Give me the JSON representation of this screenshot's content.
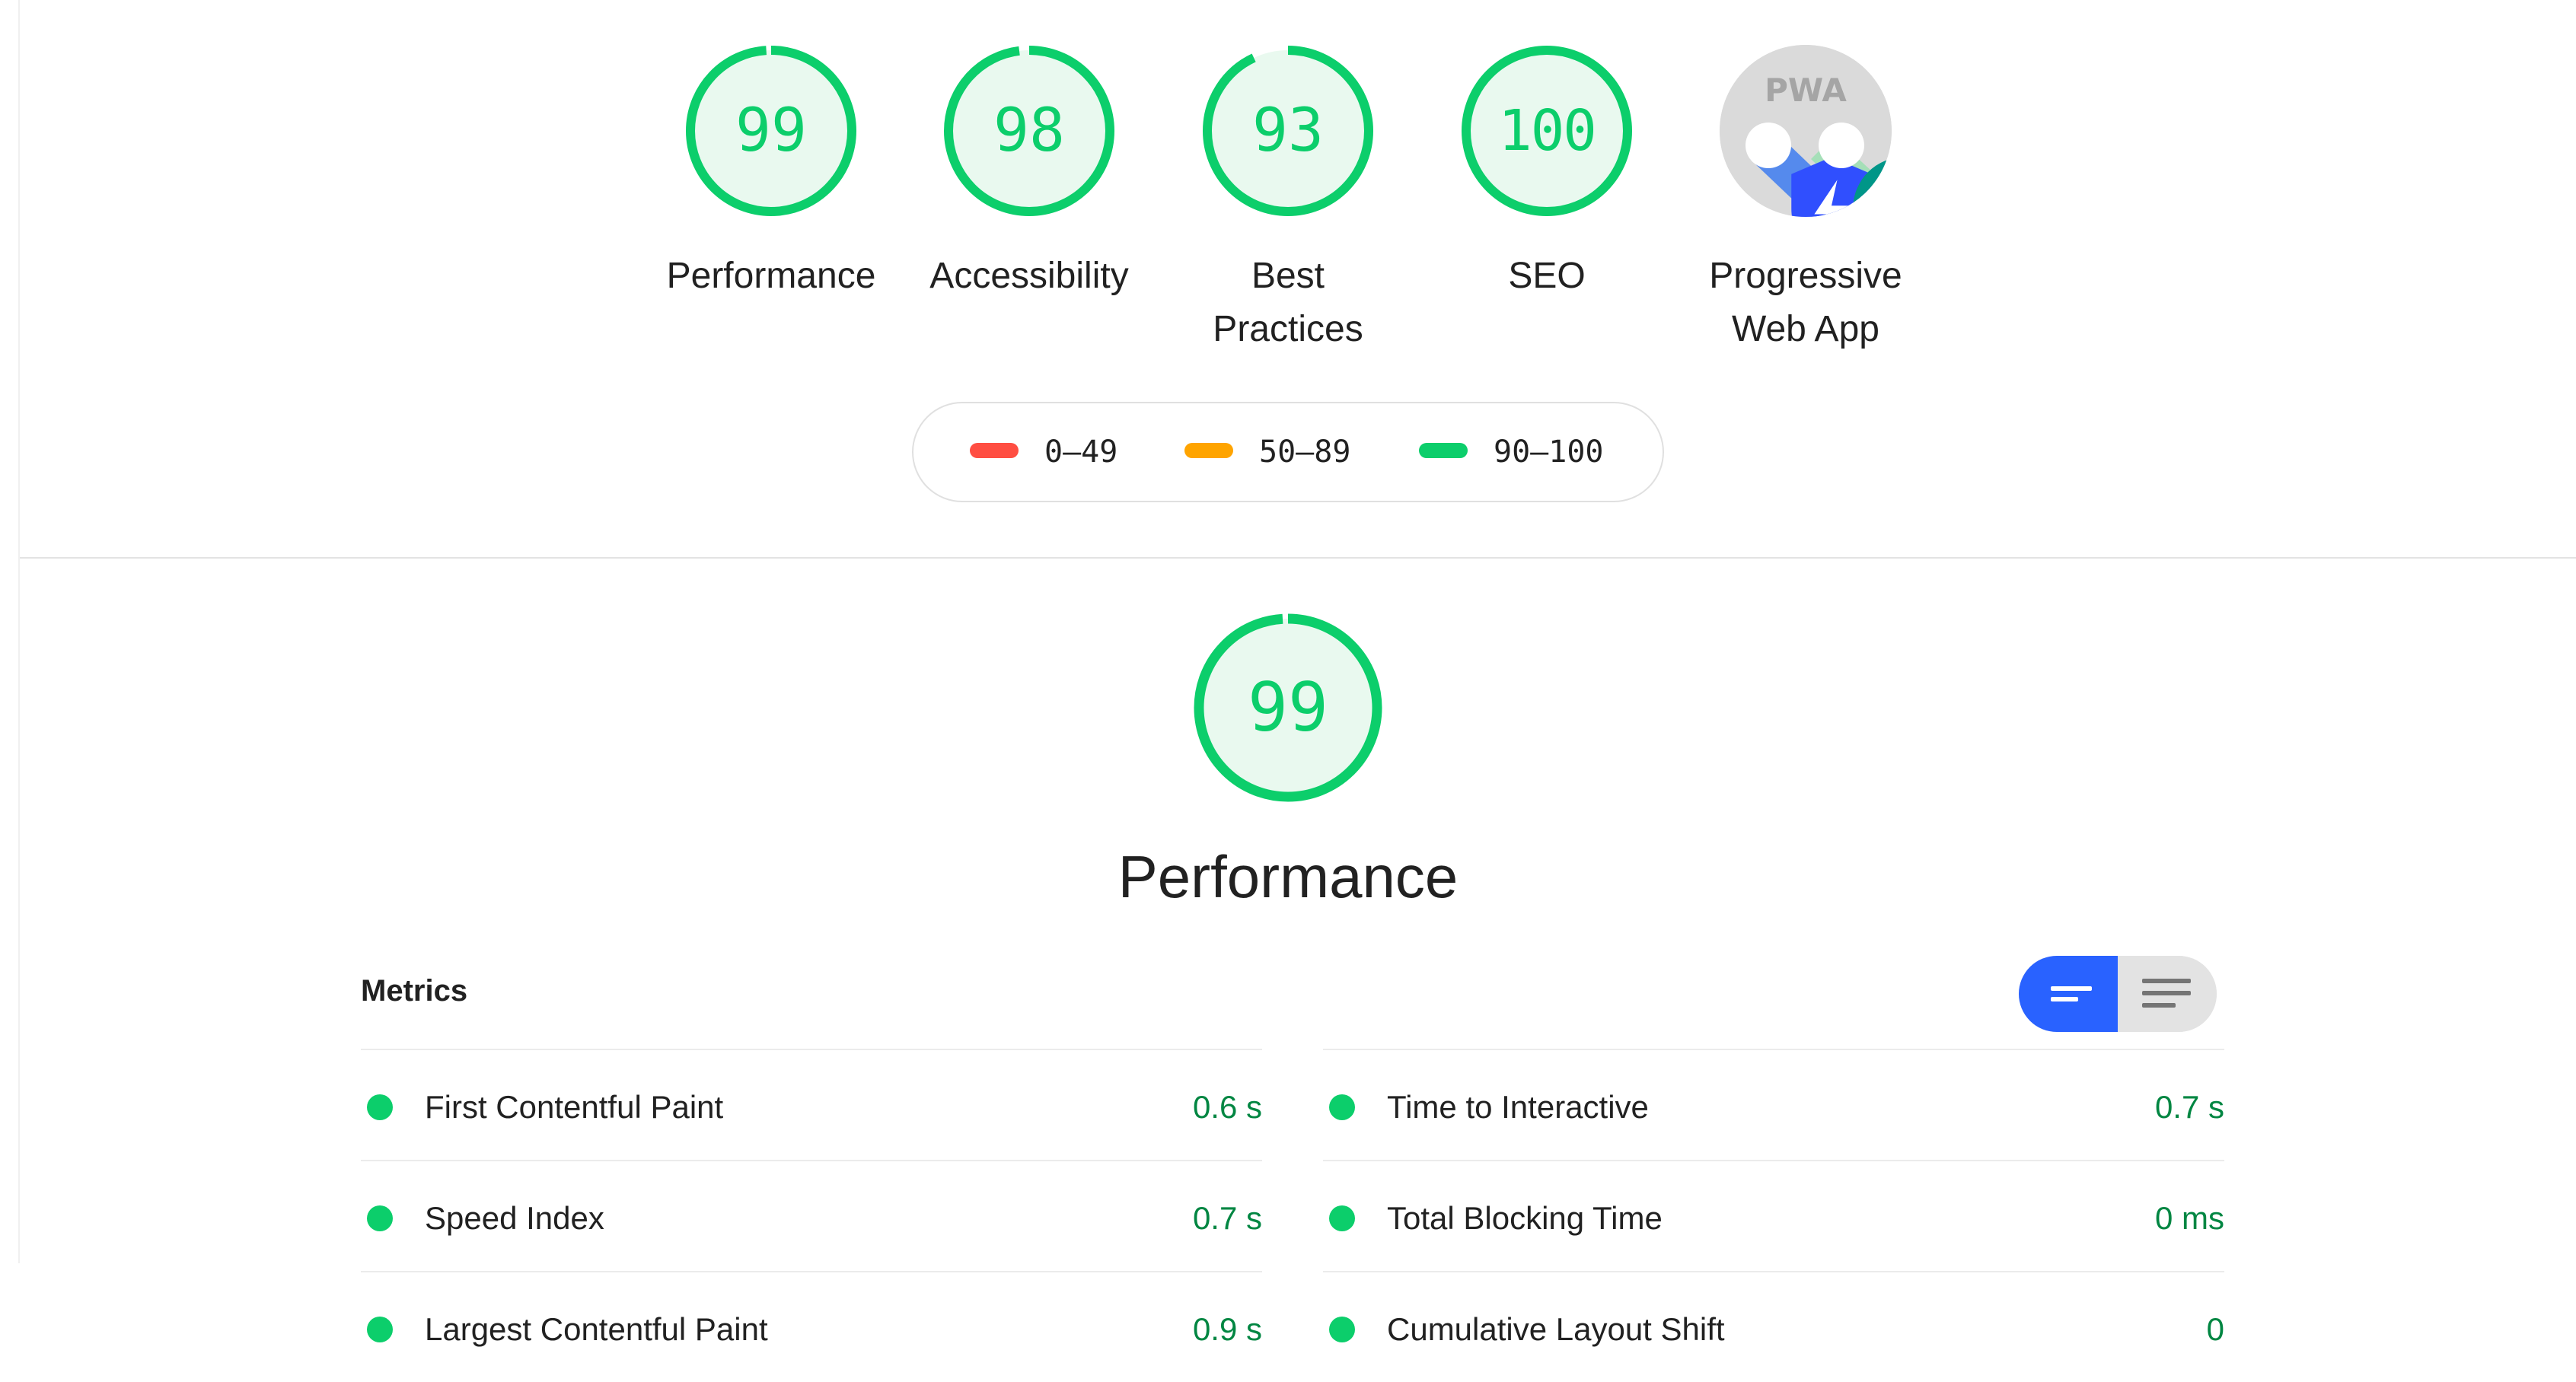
{
  "colors": {
    "pass": "#0cce6b",
    "pass_fill": "#e9f9ef",
    "pass_text": "#018642",
    "average": "#ffa400",
    "fail": "#ff4e42",
    "toggle_active": "#2962ff"
  },
  "categories": [
    {
      "score": "99",
      "score_value": 99,
      "label": "Performance"
    },
    {
      "score": "98",
      "score_value": 98,
      "label": "Accessibility"
    },
    {
      "score": "93",
      "score_value": 93,
      "label": "Best Practices"
    },
    {
      "score": "100",
      "score_value": 100,
      "label": "SEO"
    }
  ],
  "pwa": {
    "badge_text": "PWA",
    "label": "Progressive Web App",
    "icons": [
      "fast-reliable-shield-icon",
      "installable-plus-icon"
    ]
  },
  "legend": [
    {
      "range": "0–49",
      "color": "#ff4e42"
    },
    {
      "range": "50–89",
      "color": "#ffa400"
    },
    {
      "range": "90–100",
      "color": "#0cce6b"
    }
  ],
  "section": {
    "score": "99",
    "score_value": 99,
    "title": "Performance"
  },
  "metrics": {
    "heading": "Metrics",
    "view_toggle": [
      "compact-view-icon",
      "expanded-view-icon"
    ],
    "left": [
      {
        "name": "First Contentful Paint",
        "value": "0.6 s"
      },
      {
        "name": "Speed Index",
        "value": "0.7 s"
      },
      {
        "name": "Largest Contentful Paint",
        "value": "0.9 s"
      }
    ],
    "right": [
      {
        "name": "Time to Interactive",
        "value": "0.7 s"
      },
      {
        "name": "Total Blocking Time",
        "value": "0 ms"
      },
      {
        "name": "Cumulative Layout Shift",
        "value": "0"
      }
    ]
  }
}
